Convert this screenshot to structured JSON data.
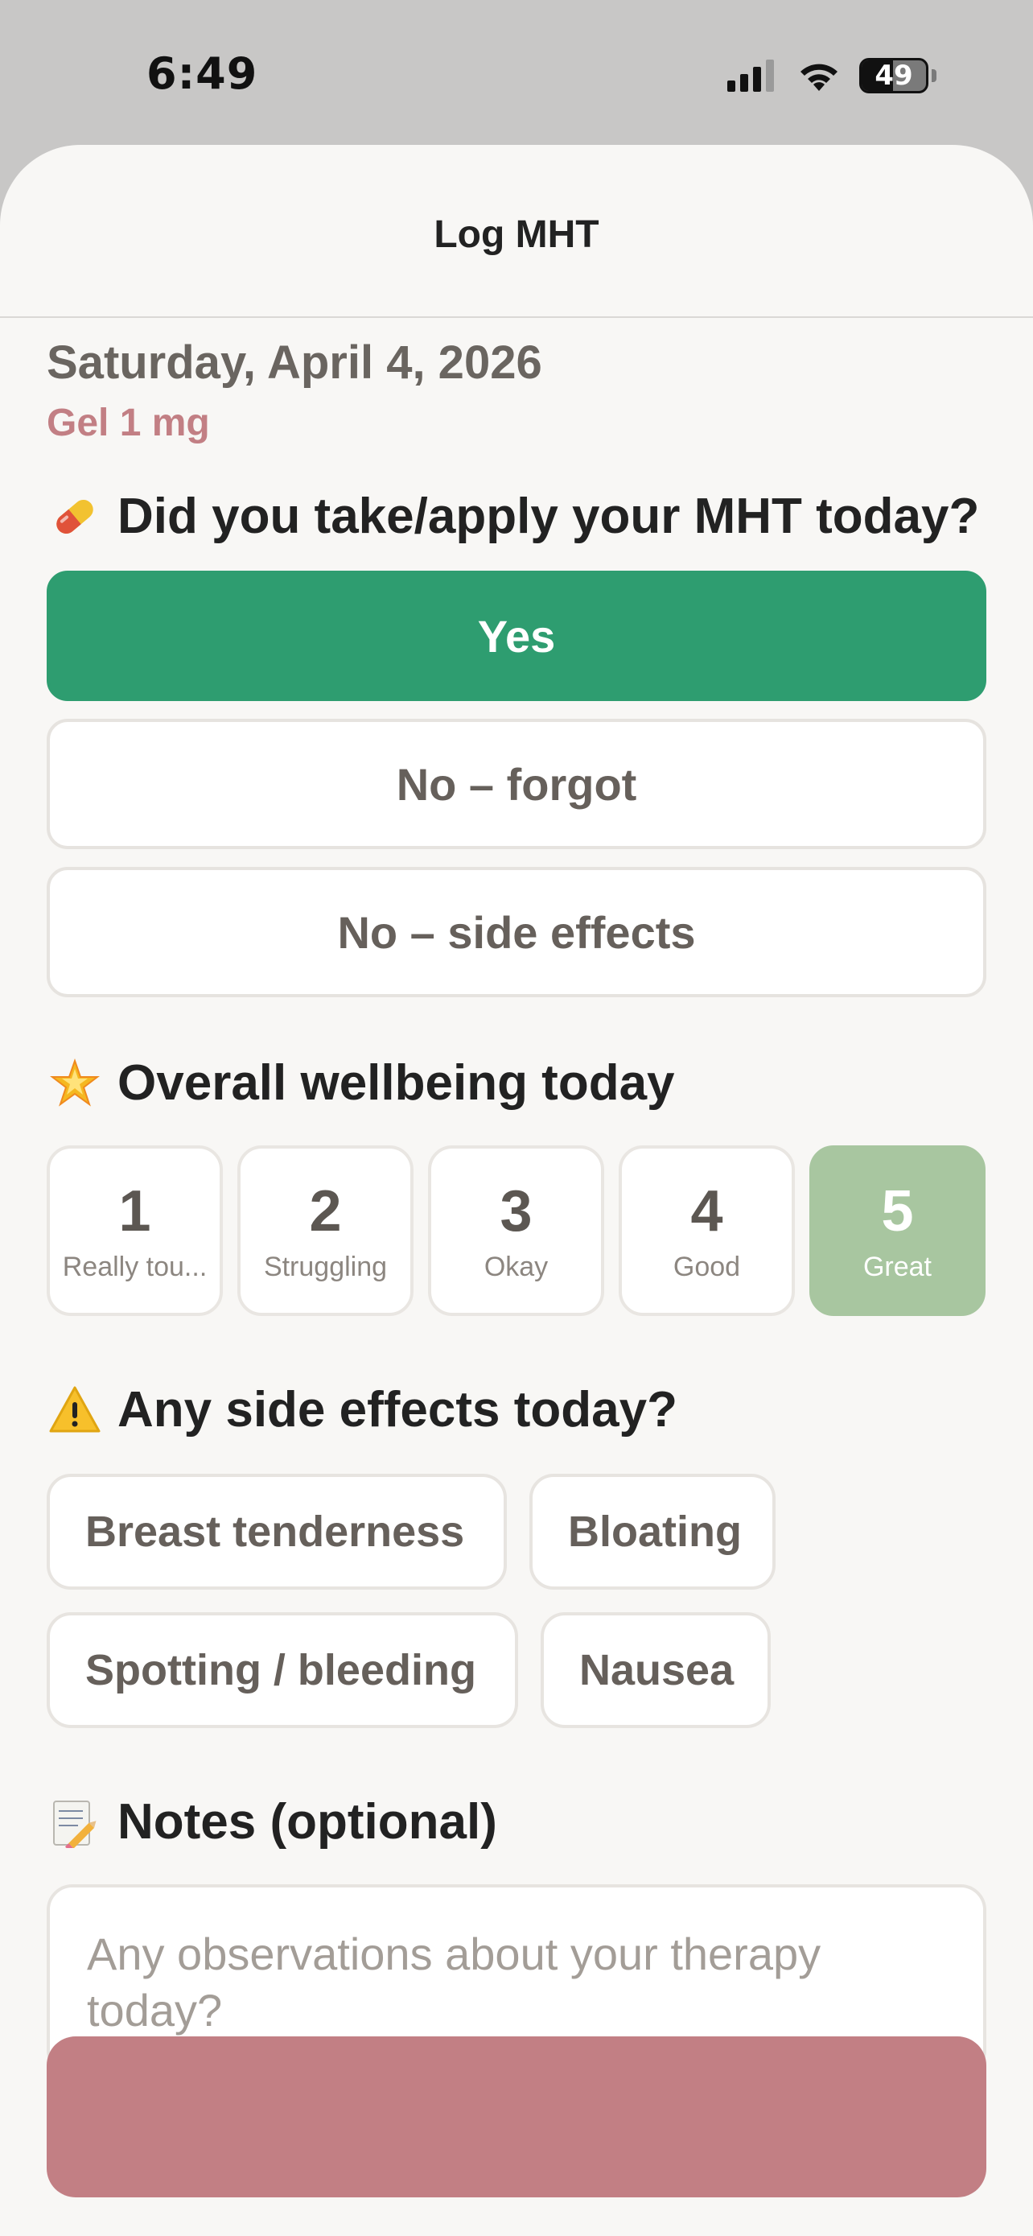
{
  "status_bar": {
    "time": "6:49",
    "battery_level": "49",
    "battery_fraction": 0.49
  },
  "header": {
    "title": "Log MHT"
  },
  "entry": {
    "date": "Saturday, April 4, 2026",
    "dose": "Gel 1 mg"
  },
  "taken_question": {
    "emoji": "💊",
    "title": "Did you take/apply your MHT today?",
    "options": [
      {
        "label": "Yes",
        "selected": true
      },
      {
        "label": "No – forgot",
        "selected": false
      },
      {
        "label": "No – side effects",
        "selected": false
      }
    ]
  },
  "wellbeing": {
    "emoji": "🌟",
    "title": "Overall wellbeing today",
    "selected": 5,
    "ratings": [
      {
        "value": "1",
        "label": "Really tou..."
      },
      {
        "value": "2",
        "label": "Struggling"
      },
      {
        "value": "3",
        "label": "Okay"
      },
      {
        "value": "4",
        "label": "Good"
      },
      {
        "value": "5",
        "label": "Great"
      }
    ]
  },
  "side_effects": {
    "emoji": "⚠️",
    "title": "Any side effects today?",
    "chips": [
      "Breast tenderness",
      "Bloating",
      "Spotting / bleeding",
      "Nausea"
    ]
  },
  "notes": {
    "emoji": "📝",
    "title": "Notes (optional)",
    "placeholder": "Any observations about your therapy today?",
    "value": ""
  },
  "colors": {
    "accent_green": "#2e9d70",
    "rating_selected": "#a8c6a0",
    "dose_pink": "#c27f84",
    "background": "#f8f7f5"
  }
}
